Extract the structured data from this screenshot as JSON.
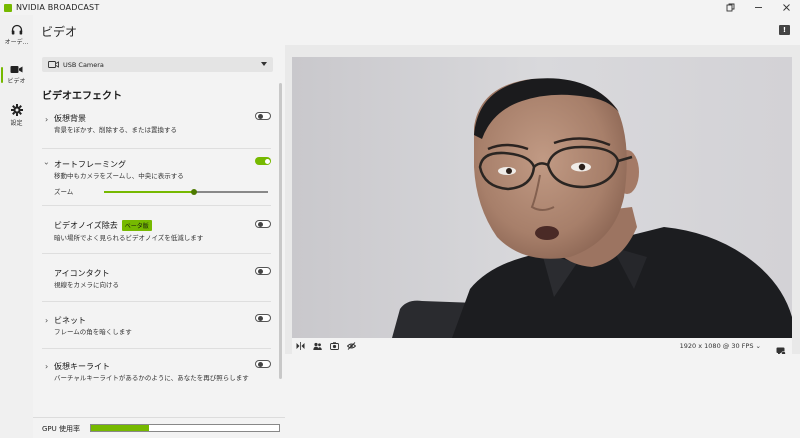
{
  "app": {
    "title": "NVIDIA BROADCAST",
    "accent_color": "#76b900"
  },
  "window_controls": {
    "restore_icon": "restore-icon",
    "minimize_icon": "minimize-icon",
    "close_icon": "close-icon"
  },
  "rail": {
    "items": [
      {
        "label": "オーデ...",
        "icon": "headphones-icon"
      },
      {
        "label": "ビデオ",
        "icon": "video-camera-icon"
      },
      {
        "label": "設定",
        "icon": "gear-icon"
      }
    ]
  },
  "header": {
    "title": "ビデオ",
    "alert_icon": "alert-icon"
  },
  "camera_select": {
    "value": "USB Camera"
  },
  "effects_title": "ビデオエフェクト",
  "effects": [
    {
      "name": "仮想背景",
      "desc": "背景をぼかす、削除する、または置換する",
      "on": false,
      "expandable": true
    },
    {
      "name": "オートフレーミング",
      "desc": "移動中もカメラをズームし、中央に表示する",
      "on": true,
      "expandable": true,
      "slider_label": "ズーム",
      "slider_value": 0.55
    },
    {
      "name": "ビデオノイズ除去",
      "badge": "ベータ版",
      "desc": "暗い場所でよく見られるビデオノイズを低減します",
      "on": false,
      "expandable": false
    },
    {
      "name": "アイコンタクト",
      "desc": "視線をカメラに向ける",
      "on": false,
      "expandable": false
    },
    {
      "name": "ビネット",
      "desc": "フレームの角を暗くします",
      "on": false,
      "expandable": true
    },
    {
      "name": "仮想キーライト",
      "desc": "バーチャルキーライトがあるかのように、あなたを再び照らします",
      "on": false,
      "expandable": true
    }
  ],
  "gpu": {
    "label": "GPU 使用率",
    "usage": 0.31
  },
  "video": {
    "resolution_text": "1920 x 1080 @ 30 FPS"
  }
}
